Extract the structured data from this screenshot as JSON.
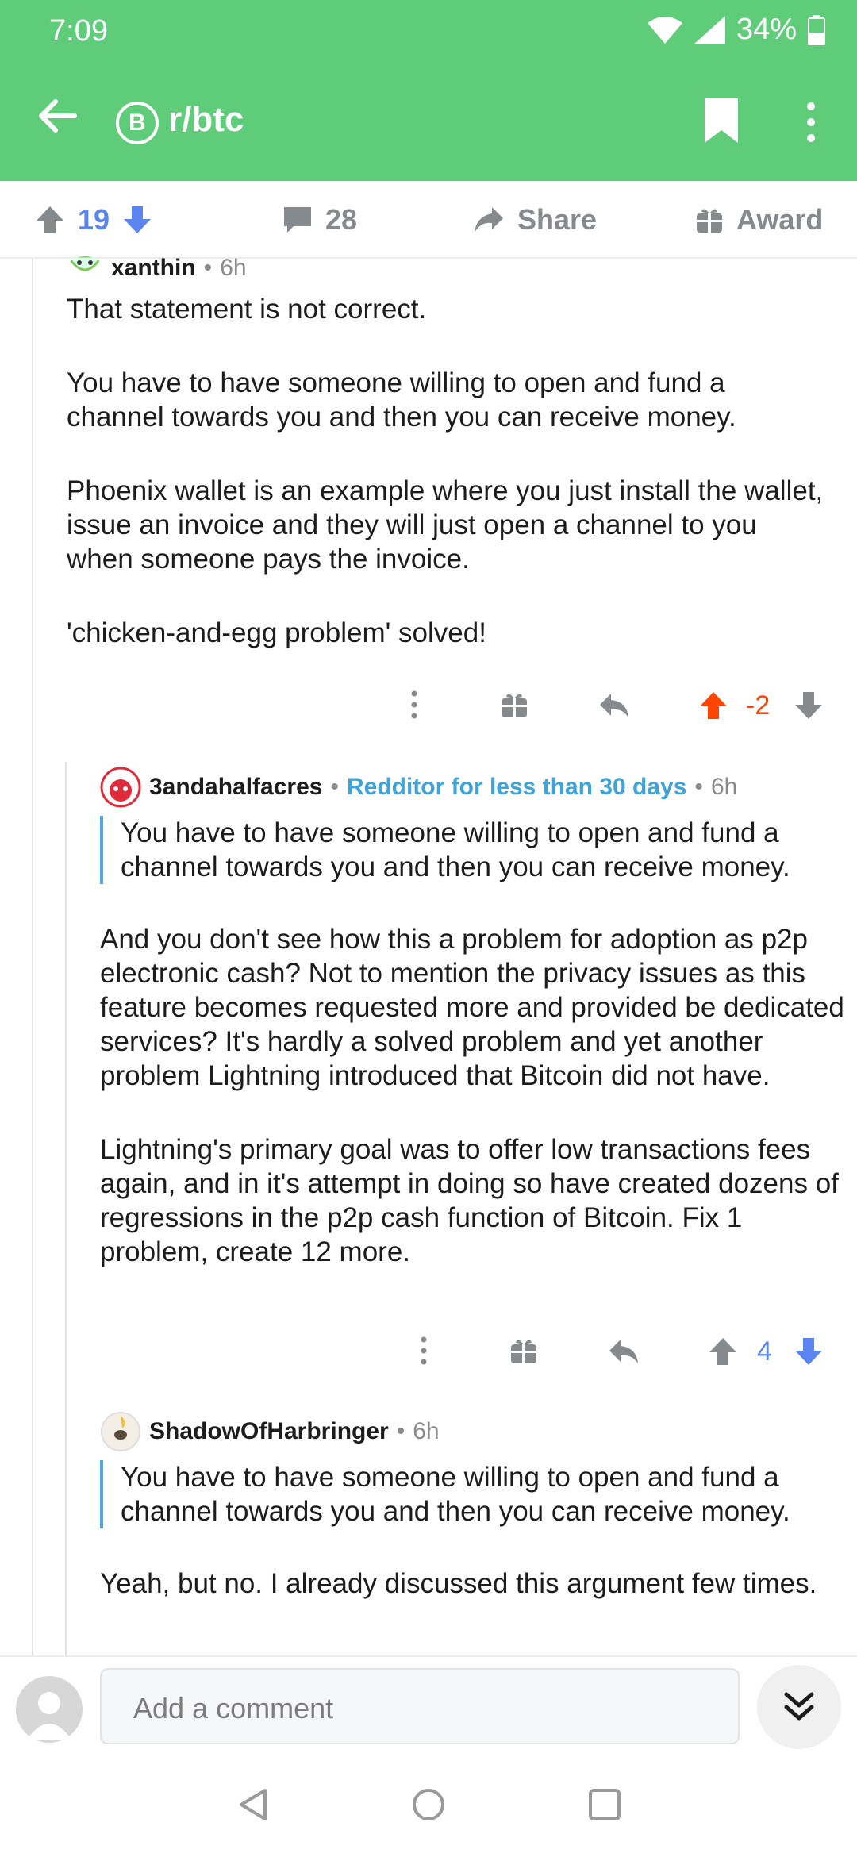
{
  "status": {
    "time": "7:09",
    "battery": "34%"
  },
  "app_bar": {
    "subreddit": "r/btc",
    "sub_icon_glyph": "B"
  },
  "post_actions": {
    "score": "19",
    "comments": "28",
    "share": "Share",
    "award": "Award"
  },
  "comments": [
    {
      "author": "xanthin",
      "age": "6h",
      "paragraphs": [
        "That statement is not correct.",
        "You have to have someone willing to open and fund a channel towards you and then you can receive money.",
        "Phoenix wallet is an example where you just install the wallet, issue an invoice and they will just open a channel to you when someone pays the invoice.",
        "'chicken-and-egg problem' solved!"
      ],
      "score": "-2"
    },
    {
      "author": "3andahalfacres",
      "flair": "Redditor for less than 30 days",
      "age": "6h",
      "quote": "You have to have someone willing to open and fund a channel towards you and then you can receive money.",
      "paragraphs": [
        "And you don't see how this a problem for adoption as p2p electronic cash? Not to mention the privacy issues as this feature becomes requested more and provided be dedicated services? It's hardly a solved problem and yet another problem Lightning introduced that Bitcoin did not have.",
        "Lightning's primary goal was to offer low transactions fees again, and in it's attempt in doing so have created dozens of regressions in the p2p cash function of Bitcoin. Fix 1 problem, create 12 more."
      ],
      "score": "4"
    },
    {
      "author": "ShadowOfHarbringer",
      "age": "6h",
      "quote": "You have to have someone willing to open and fund a channel towards you and then you can receive money.",
      "paragraphs": [
        "Yeah, but no. I already discussed this argument few times."
      ]
    }
  ],
  "composer": {
    "placeholder": "Add a comment"
  },
  "colors": {
    "header_green": "#5ecc79",
    "upvote_orange": "#ff4500",
    "downvote_blue": "#5b84f0",
    "flair_blue": "#3da3d8"
  }
}
